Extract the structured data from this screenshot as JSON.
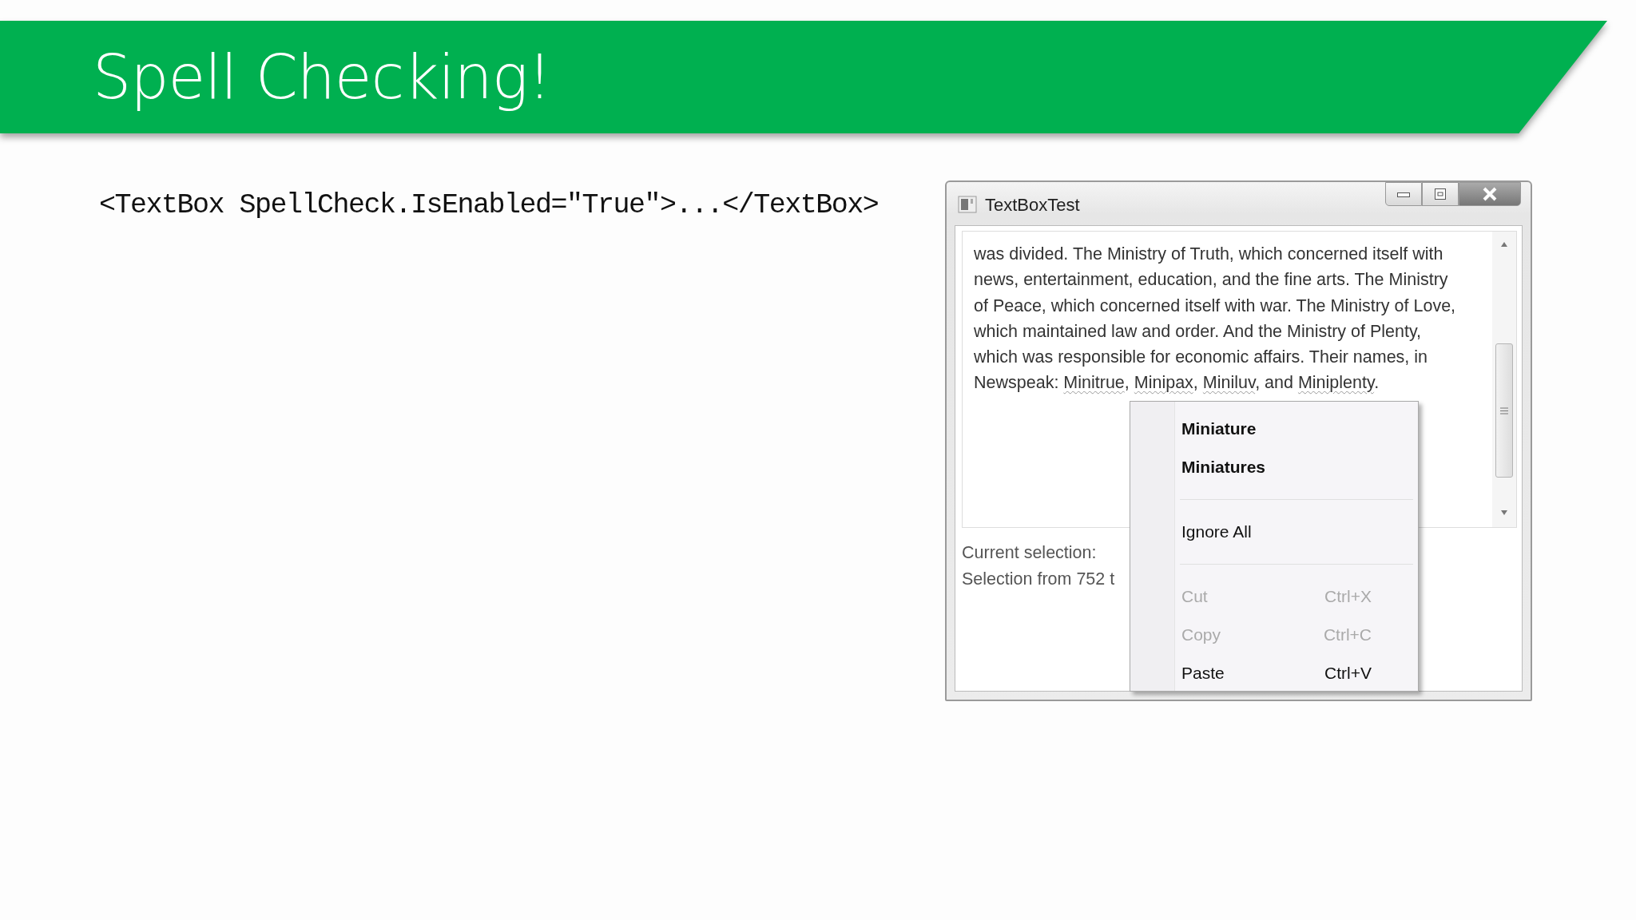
{
  "slide_title": "Spell Checking!",
  "code_line": "<TextBox SpellCheck.IsEnabled=\"True\">...</TextBox>",
  "window": {
    "title": "TextBoxTest",
    "text_lines": [
      {
        "segments": [
          {
            "text": "was divided. The Ministry of Truth, which concerned itself with",
            "misspelled": false
          }
        ]
      },
      {
        "segments": [
          {
            "text": "news, entertainment, education, and the fine arts. The Ministry",
            "misspelled": false
          }
        ]
      },
      {
        "segments": [
          {
            "text": "of Peace, which concerned itself with war. The Ministry of Love,",
            "misspelled": false
          }
        ]
      },
      {
        "segments": [
          {
            "text": "which maintained law and order. And the Ministry of Plenty,",
            "misspelled": false
          }
        ]
      },
      {
        "segments": [
          {
            "text": "which was responsible for economic affairs. Their names, in",
            "misspelled": false
          }
        ]
      },
      {
        "segments": [
          {
            "text": "Newspeak: ",
            "misspelled": false
          },
          {
            "text": "Minitrue",
            "misspelled": true
          },
          {
            "text": ", ",
            "misspelled": false
          },
          {
            "text": "Minipax",
            "misspelled": true
          },
          {
            "text": ", ",
            "misspelled": false
          },
          {
            "text": "Miniluv",
            "misspelled": true
          },
          {
            "text": ", and ",
            "misspelled": false
          },
          {
            "text": "Miniplenty",
            "misspelled": true
          },
          {
            "text": ".",
            "misspelled": false
          }
        ]
      }
    ],
    "status_lines": [
      "Current selection:",
      "Selection from 752 t"
    ]
  },
  "context_menu": [
    {
      "kind": "suggestion",
      "label": "Miniature"
    },
    {
      "kind": "suggestion",
      "label": "Miniatures"
    },
    {
      "kind": "separator"
    },
    {
      "kind": "command",
      "label": "Ignore All",
      "disabled": false
    },
    {
      "kind": "separator"
    },
    {
      "kind": "command",
      "label": "Cut",
      "shortcut": "Ctrl+X",
      "disabled": true
    },
    {
      "kind": "command",
      "label": "Copy",
      "shortcut": "Ctrl+C",
      "disabled": true
    },
    {
      "kind": "command",
      "label": "Paste",
      "shortcut": "Ctrl+V",
      "disabled": false
    }
  ]
}
